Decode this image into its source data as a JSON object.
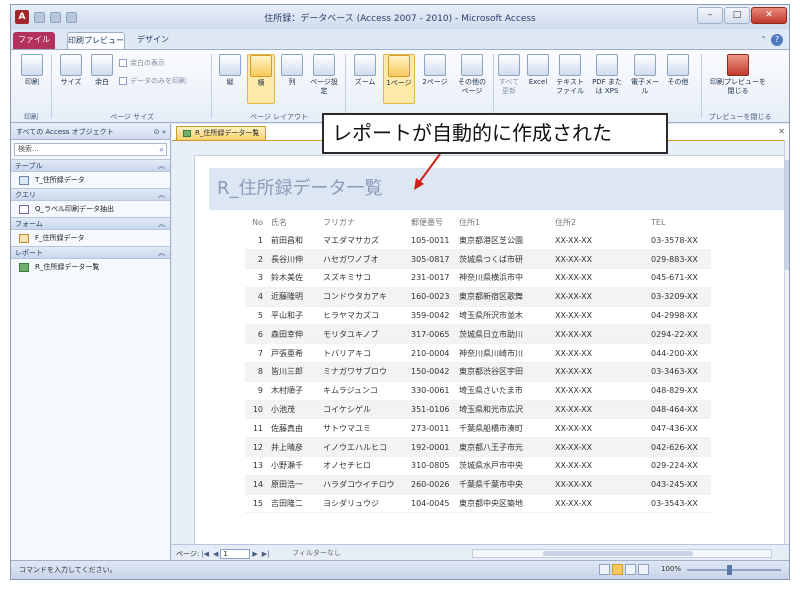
{
  "window": {
    "title": "住所録：データベース (Access 2007 - 2010) - Microsoft Access",
    "app_icon": "A"
  },
  "ribbon_tabs": {
    "file": "ファイル",
    "print_preview": "印刷プレビュー",
    "design": "デザイン"
  },
  "ribbon": {
    "print": "印刷",
    "size": "サイズ",
    "margin": "余白",
    "show_margin": "余白の表示",
    "data_only": "データのみを印刷",
    "portrait": "縦",
    "landscape": "横",
    "columns": "列",
    "page_setup": "ページ設定",
    "zoom": "ズーム",
    "one_page": "1ページ",
    "two_pages": "2ページ",
    "other_pages": "その他のページ",
    "refresh_all": "すべて更新",
    "excel": "Excel",
    "text_file": "テキストファイル",
    "pdf_xps": "PDF または XPS",
    "email": "電子メール",
    "more": "その他",
    "close_preview": "印刷プレビューを閉じる",
    "group_print": "印刷",
    "group_page_size": "ページ サイズ",
    "group_page_layout": "ページ レイアウト",
    "group_preview": "プレビューを閉じる"
  },
  "nav": {
    "header": "すべての Access オブジェクト",
    "search_placeholder": "検索...",
    "groups": {
      "tables": "テーブル",
      "queries": "クエリ",
      "forms": "フォーム",
      "reports": "レポート"
    },
    "items": {
      "table": "T_住所録データ",
      "query": "Q_ラベル印刷データ抽出",
      "form": "F_住所録データ",
      "report": "R_住所録データ一覧"
    }
  },
  "document": {
    "tab_label": "R_住所録データ一覧",
    "report_title": "R_住所録データ一覧",
    "columns": [
      "No",
      "氏名",
      "フリガナ",
      "郵便番号",
      "住所1",
      "住所2",
      "TEL"
    ],
    "rows": [
      [
        "1",
        "前田昌和",
        "マエダマサカズ",
        "105-0011",
        "東京都港区芝公園",
        "XX-XX-XX",
        "03-3578-XX"
      ],
      [
        "2",
        "長谷川伸",
        "ハセガワノブオ",
        "305-0817",
        "茨城県つくば市研",
        "XX-XX-XX",
        "029-883-XX"
      ],
      [
        "3",
        "鈴木美佐",
        "スズキミサコ",
        "231-0017",
        "神奈川県横浜市中",
        "XX-XX-XX",
        "045-671-XX"
      ],
      [
        "4",
        "近藤隆明",
        "コンドウタカアキ",
        "160-0023",
        "東京都新宿区歌舞",
        "XX-XX-XX",
        "03-3209-XX"
      ],
      [
        "5",
        "平山和子",
        "ヒラヤマカズコ",
        "359-0042",
        "埼玉県所沢市並木",
        "XX-XX-XX",
        "04-2998-XX"
      ],
      [
        "6",
        "森田幸伸",
        "モリタユキノブ",
        "317-0065",
        "茨城県日立市助川",
        "XX-XX-XX",
        "0294-22-XX"
      ],
      [
        "7",
        "戸張亜希",
        "トバリアキコ",
        "210-0004",
        "神奈川県川崎市川",
        "XX-XX-XX",
        "044-200-XX"
      ],
      [
        "8",
        "皆川三郎",
        "ミナガワサブロウ",
        "150-0042",
        "東京都渋谷区宇田",
        "XX-XX-XX",
        "03-3463-XX"
      ],
      [
        "9",
        "木村順子",
        "キムラジュンコ",
        "330-0061",
        "埼玉県さいたま市",
        "XX-XX-XX",
        "048-829-XX"
      ],
      [
        "10",
        "小池茂",
        "コイケシゲル",
        "351-0106",
        "埼玉県和光市広沢",
        "XX-XX-XX",
        "048-464-XX"
      ],
      [
        "11",
        "佐藤真由",
        "サトウマユミ",
        "273-0011",
        "千葉県船橋市湊町",
        "XX-XX-XX",
        "047-436-XX"
      ],
      [
        "12",
        "井上晴彦",
        "イノウエハルヒコ",
        "192-0001",
        "東京都八王子市元",
        "XX-XX-XX",
        "042-626-XX"
      ],
      [
        "13",
        "小野瀬千",
        "オノセチヒロ",
        "310-0805",
        "茨城県水戸市中央",
        "XX-XX-XX",
        "029-224-XX"
      ],
      [
        "14",
        "原田浩一",
        "ハラダコウイチロウ",
        "260-0026",
        "千葉県千葉市中央",
        "XX-XX-XX",
        "043-245-XX"
      ],
      [
        "15",
        "吉田隆二",
        "ヨシダリュウジ",
        "104-0045",
        "東京都中央区築地",
        "XX-XX-XX",
        "03-3543-XX"
      ]
    ],
    "page_nav_label": "ページ:",
    "page_number": "1",
    "filter_label": "フィルターなし"
  },
  "callout": {
    "text": "レポートが自動的に作成された"
  },
  "status": {
    "text": "コマンドを入力してください。",
    "zoom": "100%"
  }
}
